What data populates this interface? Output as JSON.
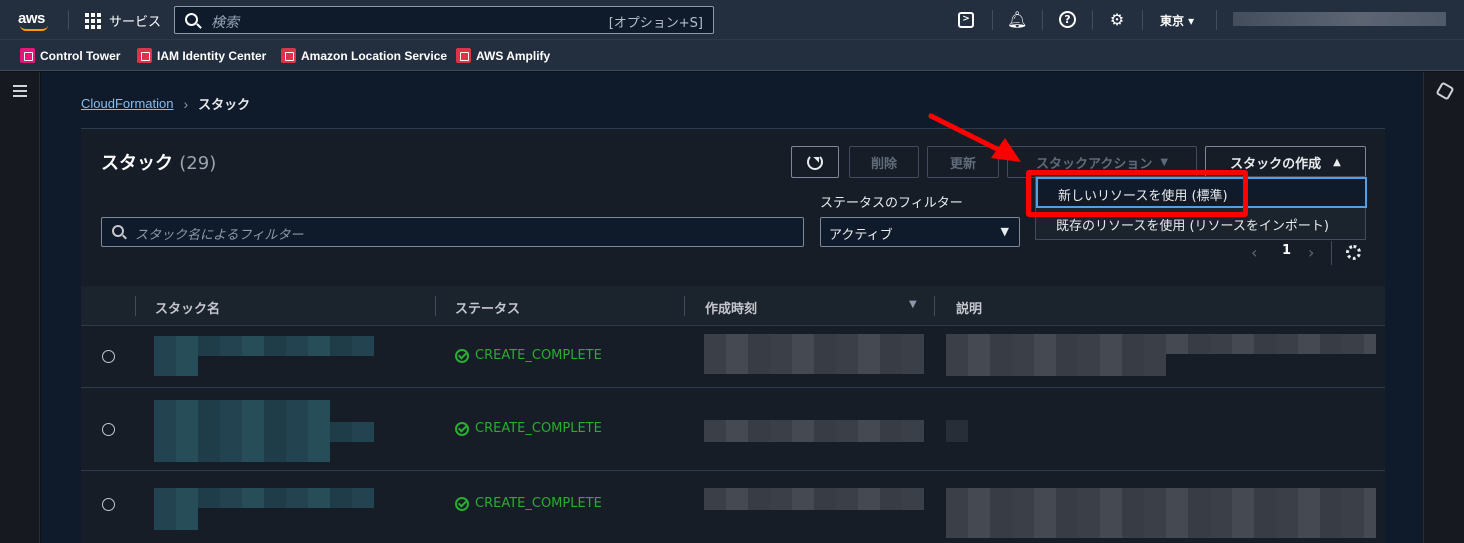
{
  "topnav": {
    "logo_text": "aws",
    "services_label": "サービス",
    "search_placeholder": "検索",
    "search_shortcut": "[オプション+S]",
    "region": "東京 ▾"
  },
  "favorites": [
    {
      "label": "Control Tower",
      "color": "#e7157b"
    },
    {
      "label": "IAM Identity Center",
      "color": "#dd344c"
    },
    {
      "label": "Amazon Location Service",
      "color": "#dd344c"
    },
    {
      "label": "AWS Amplify",
      "color": "#dd344c"
    }
  ],
  "breadcrumb": {
    "root": "CloudFormation",
    "current": "スタック"
  },
  "stacks": {
    "title": "スタック",
    "count": "(29)",
    "buttons": {
      "delete": "削除",
      "update": "更新",
      "actions": "スタックアクション",
      "create": "スタックの作成"
    },
    "filter_placeholder": "スタック名によるフィルター",
    "status_filter_label": "ステータスのフィルター",
    "status_filter_value": "アクティブ",
    "page": "1",
    "columns": [
      "スタック名",
      "ステータス",
      "作成時刻",
      "説明"
    ],
    "rows": [
      {
        "status": "CREATE_COMPLETE"
      },
      {
        "status": "CREATE_COMPLETE"
      },
      {
        "status": "CREATE_COMPLETE"
      }
    ]
  },
  "create_menu": {
    "items": [
      "新しいリソースを使用 (標準)",
      "既存のリソースを使用 (リソースをインポート)"
    ]
  },
  "colors": {
    "accent": "#539fe5",
    "success": "#29ad32",
    "highlight": "#ff0000"
  }
}
